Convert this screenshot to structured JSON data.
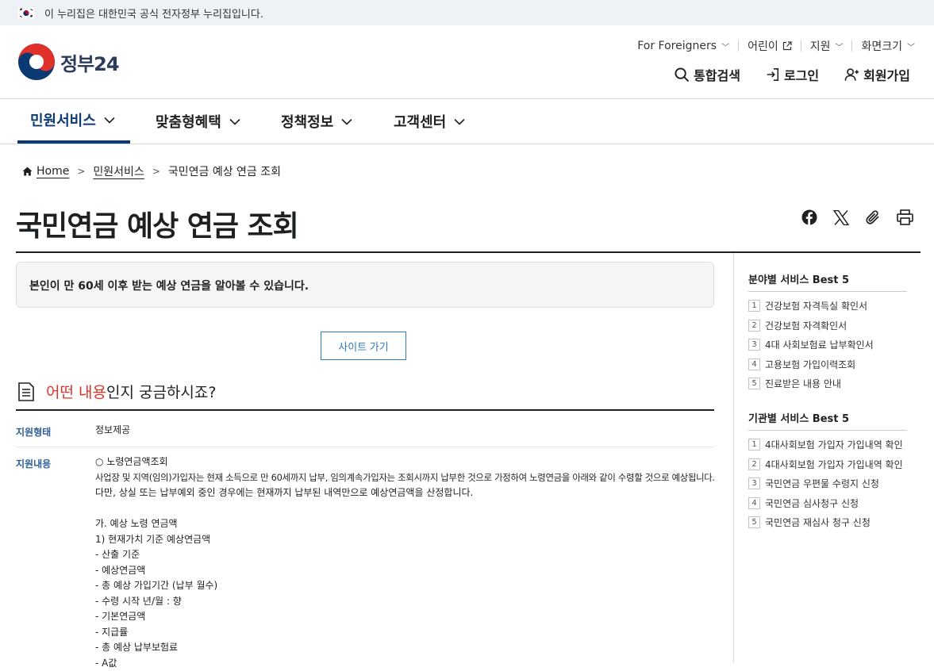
{
  "gov_banner": {
    "text": "이 누리집은 대한민국 공식 전자정부 누리집입니다."
  },
  "logo": {
    "text": "정부24"
  },
  "util_links": [
    "For Foreigners",
    "어린이",
    "지원",
    "화면크기"
  ],
  "main_util": {
    "search": "통합검색",
    "login": "로그인",
    "signup": "회원가입"
  },
  "gnb": [
    "민원서비스",
    "맞춤형혜택",
    "정책정보",
    "고객센터"
  ],
  "breadcrumb": {
    "home": "Home",
    "level1": "민원서비스",
    "current": "국민연금 예상 연금 조회"
  },
  "page_title": "국민연금 예상 연금 조회",
  "summary": "본인이 만 60세 이후 받는 예상 연금을 알아볼 수 있습니다.",
  "site_button": "사이트 가기",
  "section": {
    "highlight": "어떤 내용",
    "rest": "인지 궁금하시죠?"
  },
  "details": {
    "type_label": "지원형태",
    "type_value": "정보제공",
    "content_label": "지원내용",
    "content_lines": [
      "○ 노령연금액조회",
      "사업장 및 지역(임의)가입자는 현재 소득으로 만 60세까지 납부, 임의계속가입자는 조회시까지 납부한 것으로 가정하여 노령연금을 아래와 같이 수령할 것으로 예상됩니다.",
      "다만, 상실 또는 납부예외 중인 경우에는 현재까지 납부된 내역만으로 예상연금액을 산정합니다.",
      "",
      "가. 예상 노령 연금액",
      "1) 현재가치 기준 예상연금액",
      "- 산출 기준",
      "- 예상연금액",
      "- 총 예상 가입기간 (납부 월수)",
      "- 수령 시작 년/월 : 향",
      "- 기본연금액",
      "- 지급률",
      "- 총 예상 납부보험료",
      "- A값"
    ]
  },
  "sidebar": {
    "best_field_title": "분야별 서비스 Best 5",
    "best_field": [
      "건강보험 자격득실 확인서",
      "건강보험 자격확인서",
      "4대 사회보험료 납부확인서",
      "고용보험 가입이력조회",
      "진료받은 내용 안내"
    ],
    "best_org_title": "기관별 서비스 Best 5",
    "best_org": [
      "4대사회보험 가입자 가입내역 확인",
      "4대사회보험 가입자 가입내역 확인",
      "국민연금 우편물 수령지 신청",
      "국민연금 심사청구 신청",
      "국민연금 재심사 청구 신청"
    ],
    "numbers": [
      "1",
      "2",
      "3",
      "4",
      "5"
    ]
  },
  "colors": {
    "primary": "#0b3a72",
    "accent_red": "#e0322b",
    "link_blue": "#2d7ab8"
  }
}
